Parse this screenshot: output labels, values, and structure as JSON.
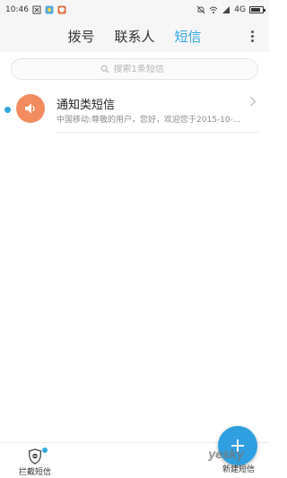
{
  "status_bar": {
    "time": "10:46",
    "network": "4G",
    "battery_level": 0.8,
    "left_icons": [
      "screen-capture-icon",
      "weather-app-icon",
      "shield-app-icon"
    ],
    "right_icons": [
      "mute-icon",
      "wifi-icon",
      "signal-icon",
      "battery-icon"
    ]
  },
  "header": {
    "tabs": [
      {
        "label": "拨号",
        "active": false
      },
      {
        "label": "联系人",
        "active": false
      },
      {
        "label": "短信",
        "active": true
      }
    ],
    "menu_icon": "more-vertical-icon"
  },
  "search": {
    "placeholder": "搜索1条短信",
    "icon": "search-icon"
  },
  "conversations": [
    {
      "title": "通知类短信",
      "preview": "中国移动:尊敬的用户，您好，欢迎您于2015-10-...",
      "unread": true,
      "avatar_icon": "speaker-icon",
      "avatar_color": "#f28c5f"
    }
  ],
  "bottom_bar": {
    "block_label": "拦截短信",
    "block_icon": "shield-block-icon",
    "new_message_label": "新建短信",
    "new_message_icon": "plus-icon"
  },
  "watermark": {
    "text": "yesky"
  },
  "colors": {
    "accent": "#31a8e0",
    "fab": "#2f9fe0",
    "avatar": "#f28c5f"
  }
}
